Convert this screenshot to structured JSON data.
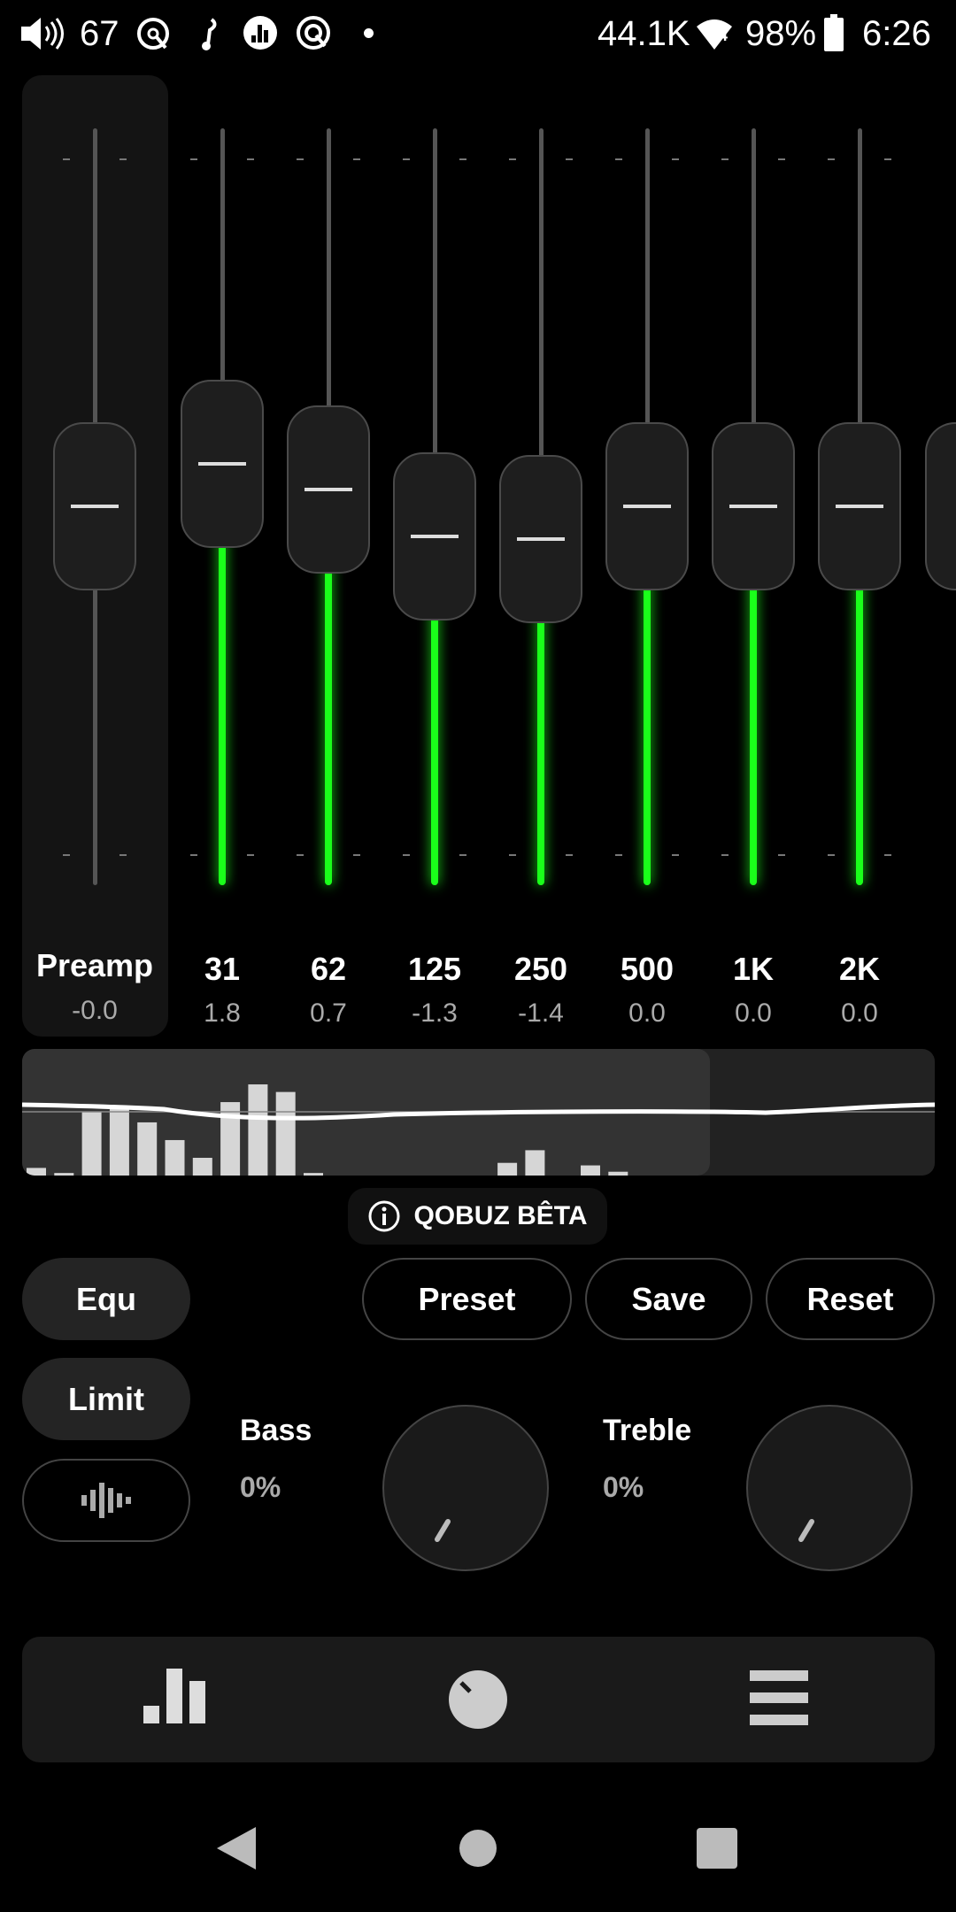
{
  "status_bar": {
    "volume": "67",
    "sample_rate": "44.1K",
    "battery": "98%",
    "time": "6:26",
    "wifi_badge": "4"
  },
  "preamp": {
    "label": "Preamp",
    "value": "-0.0",
    "level_db": 0.0
  },
  "bands": [
    {
      "label": "31",
      "value": "1.8"
    },
    {
      "label": "62",
      "value": "0.7"
    },
    {
      "label": "125",
      "value": "-1.3"
    },
    {
      "label": "250",
      "value": "-1.4"
    },
    {
      "label": "500",
      "value": "0.0"
    },
    {
      "label": "1K",
      "value": "0.0"
    },
    {
      "label": "2K",
      "value": "0.0"
    }
  ],
  "spectrum_levels": [
    0.06,
    0.02,
    0.5,
    0.55,
    0.42,
    0.28,
    0.14,
    0.58,
    0.72,
    0.66,
    0.02,
    0,
    0,
    0,
    0,
    0,
    0,
    0.1,
    0.2,
    0,
    0.08,
    0.03
  ],
  "info_pill": {
    "label": "QOBUZ BÊTA",
    "icon": "info-icon"
  },
  "buttons": {
    "equ": "Equ",
    "limit": "Limit",
    "preset": "Preset",
    "save": "Save",
    "reset": "Reset"
  },
  "bass": {
    "label": "Bass",
    "value": "0%"
  },
  "treble": {
    "label": "Treble",
    "value": "0%"
  },
  "bottom_nav": [
    "equalizer-icon",
    "knob-icon",
    "menu-icon"
  ],
  "colors": {
    "accent": "#1aff1a",
    "panel": "#141414"
  }
}
